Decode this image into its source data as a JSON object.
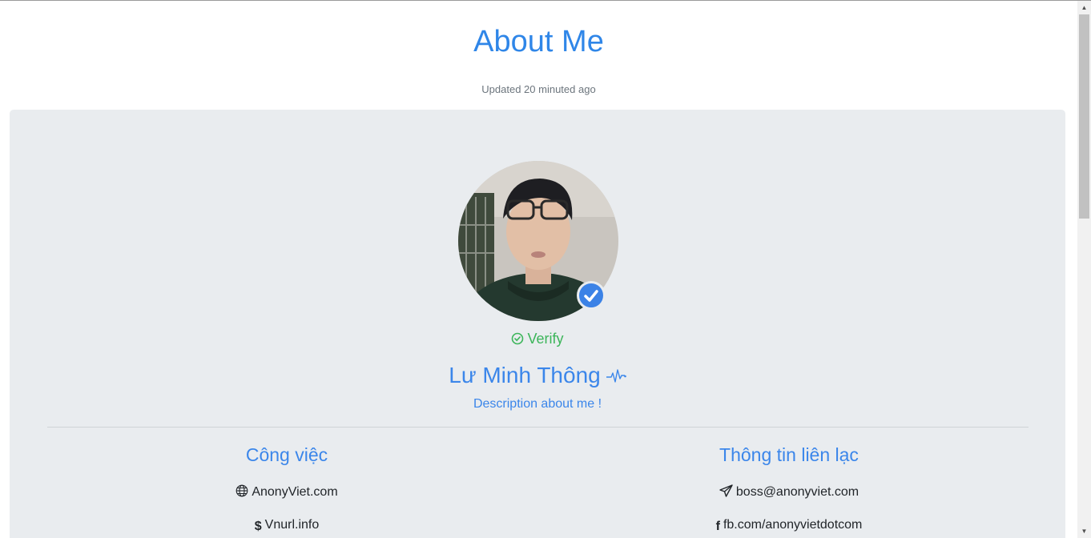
{
  "header": {
    "title": "About Me",
    "updated": "Updated 20 minuted ago"
  },
  "profile": {
    "verify_label": "Verify",
    "name": "Lư Minh Thông",
    "description": "Description about me !"
  },
  "sections": {
    "work": {
      "title": "Công việc",
      "items": [
        {
          "icon": "globe-icon",
          "text": "AnonyViet.com"
        },
        {
          "icon": "dollar-icon",
          "text": "Vnurl.info"
        }
      ]
    },
    "contact": {
      "title": "Thông tin liên lạc",
      "items": [
        {
          "icon": "paper-plane-icon",
          "text": "boss@anonyviet.com"
        },
        {
          "icon": "facebook-icon",
          "text": "fb.com/anonyvietdotcom"
        }
      ]
    }
  },
  "colors": {
    "accent": "#3b86ea",
    "verify": "#3cb55a",
    "card_bg": "#e9ecef"
  }
}
